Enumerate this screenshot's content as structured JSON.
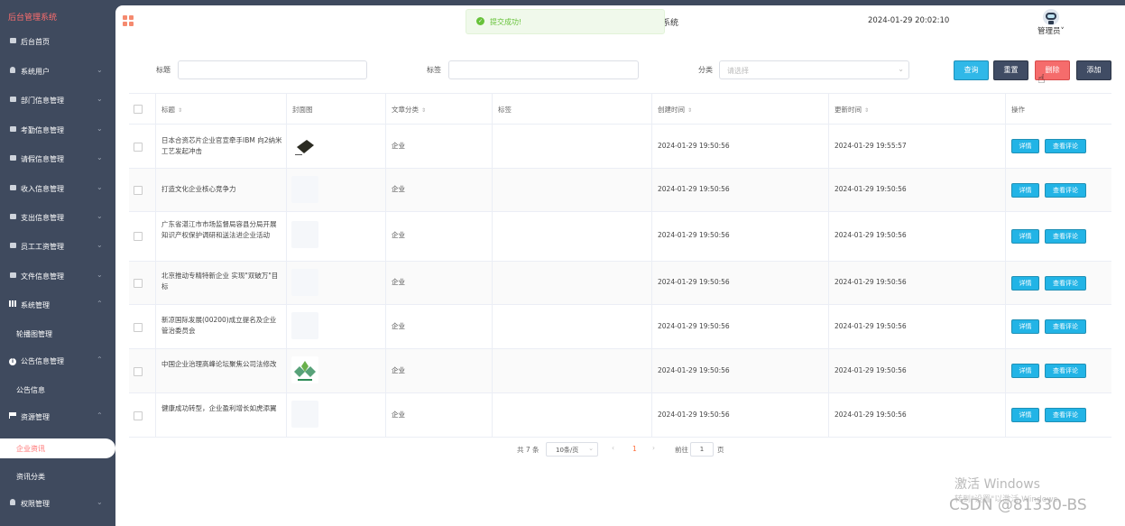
{
  "sidebar": {
    "brand": "后台管理系统",
    "items": [
      {
        "label": "后台首页",
        "icon": "home-icon",
        "chevron": ""
      },
      {
        "label": "系统用户",
        "icon": "user-icon",
        "chevron": "⌄"
      },
      {
        "label": "部门信息管理",
        "icon": "menu-icon",
        "chevron": "⌄"
      },
      {
        "label": "考勤信息管理",
        "icon": "menu-icon",
        "chevron": "⌄"
      },
      {
        "label": "请假信息管理",
        "icon": "menu-icon",
        "chevron": "⌄"
      },
      {
        "label": "收入信息管理",
        "icon": "menu-icon",
        "chevron": "⌄"
      },
      {
        "label": "支出信息管理",
        "icon": "menu-icon",
        "chevron": "⌄"
      },
      {
        "label": "员工工资管理",
        "icon": "menu-icon",
        "chevron": "⌄"
      },
      {
        "label": "文件信息管理",
        "icon": "menu-icon",
        "chevron": "⌄"
      },
      {
        "label": "系统管理",
        "icon": "chart-icon",
        "chevron": "⌃"
      },
      {
        "label": "轮播图管理",
        "icon": "",
        "chevron": ""
      },
      {
        "label": "公告信息管理",
        "icon": "info-icon",
        "chevron": "⌃"
      },
      {
        "label": "公告信息",
        "icon": "",
        "chevron": ""
      },
      {
        "label": "资源管理",
        "icon": "flag-icon",
        "chevron": "⌃"
      },
      {
        "label": "企业资讯",
        "icon": "",
        "chevron": ""
      },
      {
        "label": "资讯分类",
        "icon": "",
        "chevron": ""
      },
      {
        "label": "权限管理",
        "icon": "user-icon",
        "chevron": "⌄"
      }
    ],
    "active_item": "企业资讯"
  },
  "header": {
    "title_fragment": "系统",
    "datetime": "2024-01-29 20:02:10",
    "user_name": "管理员",
    "user_chevron": "˅"
  },
  "toast": {
    "message": "提交成功!",
    "icon": "check-circle-icon"
  },
  "filters": {
    "title_label": "标题",
    "title_value": "",
    "tag_label": "标签",
    "tag_value": "",
    "category_label": "分类",
    "category_placeholder": "请选择"
  },
  "toolbar": {
    "search": "查询",
    "reset": "重置",
    "delete": "删除",
    "add": "添加"
  },
  "table": {
    "columns": [
      "标题",
      "封面图",
      "文章分类",
      "标签",
      "创建时间",
      "更新时间",
      "操作"
    ],
    "rows": [
      {
        "title": "日本合资芯片企业官宣牵手IBM 向2纳米工艺发起冲击",
        "category": "企业",
        "tag": "",
        "created": "2024-01-29 19:50:56",
        "updated": "2024-01-29 19:55:57",
        "cover": "chip"
      },
      {
        "title": "打造文化企业核心竞争力",
        "category": "企业",
        "tag": "",
        "created": "2024-01-29 19:50:56",
        "updated": "2024-01-29 19:50:56",
        "cover": "blank"
      },
      {
        "title": "广东省湛江市市场监督局容县分局开展知识产权保护调研和送法进企业活动",
        "category": "企业",
        "tag": "",
        "created": "2024-01-29 19:50:56",
        "updated": "2024-01-29 19:50:56",
        "cover": "blank"
      },
      {
        "title": "北京推动专精特新企业 实现\"双破万\"目标",
        "category": "企业",
        "tag": "",
        "created": "2024-01-29 19:50:56",
        "updated": "2024-01-29 19:50:56",
        "cover": "blank"
      },
      {
        "title": "新凉国际发展(00200)成立提名及企业管治委员会",
        "category": "企业",
        "tag": "",
        "created": "2024-01-29 19:50:56",
        "updated": "2024-01-29 19:50:56",
        "cover": "blank"
      },
      {
        "title": "中国企业治理高峰论坛聚焦公司法修改",
        "category": "企业",
        "tag": "",
        "created": "2024-01-29 19:50:56",
        "updated": "2024-01-29 19:50:56",
        "cover": "logo"
      },
      {
        "title": "健康成功转型，企业盈利增长如虎添翼",
        "category": "企业",
        "tag": "",
        "created": "2024-01-29 19:50:56",
        "updated": "2024-01-29 19:50:56",
        "cover": "blank"
      }
    ],
    "action_detail": "详情",
    "action_comment": "查看评论"
  },
  "pagination": {
    "total": "共 7 条",
    "page_size": "10条/页",
    "prev": "‹",
    "current": "1",
    "next": "›",
    "goto_label": "前往",
    "goto_value": "1",
    "goto_suffix": "页"
  },
  "watermark": {
    "line1": "激活 Windows",
    "line2": "转到\"设置\"以激活 Windows。",
    "csdn": "CSDN @81330-BS"
  }
}
